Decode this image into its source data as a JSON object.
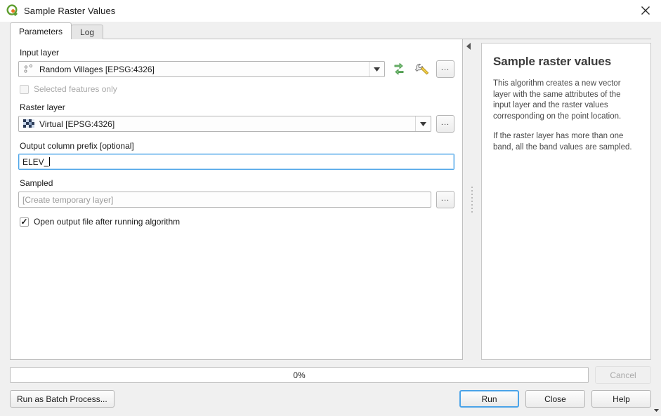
{
  "window": {
    "title": "Sample Raster Values",
    "icon": "qgis-logo-icon",
    "close_icon": "close-icon"
  },
  "tabs": [
    {
      "label": "Parameters",
      "active": true
    },
    {
      "label": "Log",
      "active": false
    }
  ],
  "parameters": {
    "input_layer": {
      "label": "Input layer",
      "value": "Random Villages [EPSG:4326]",
      "icon": "point-vector-layer-icon",
      "iterate_button_icon": "iterate-cycle-icon",
      "advanced_button_icon": "wrench-icon",
      "browse_button_label": "..."
    },
    "selected_features_only": {
      "label": "Selected features only",
      "checked": false,
      "enabled": false
    },
    "raster_layer": {
      "label": "Raster layer",
      "value": "Virtual [EPSG:4326]",
      "icon": "raster-layer-icon",
      "browse_button_label": "..."
    },
    "output_column_prefix": {
      "label": "Output column prefix [optional]",
      "value": "ELEV_",
      "placeholder": ""
    },
    "sampled": {
      "label": "Sampled",
      "value": "",
      "placeholder": "[Create temporary layer]",
      "browse_button_label": "..."
    },
    "open_output": {
      "label": "Open output file after running algorithm",
      "checked": true
    }
  },
  "help": {
    "collapse_icon": "collapse-panel-arrow-icon",
    "title": "Sample raster values",
    "paragraphs": [
      "This algorithm creates a new vector layer with the same attributes of the input layer and the raster values corresponding on the point location.",
      "If the raster layer has more than one band, all the band values are sampled."
    ]
  },
  "footer": {
    "progress_text": "0%",
    "progress_percent": 0,
    "cancel_label": "Cancel",
    "cancel_enabled": false,
    "batch_label": "Run as Batch Process...",
    "run_label": "Run",
    "close_label": "Close",
    "help_label": "Help"
  },
  "colors": {
    "accent": "#4aa3e8",
    "qgis_green": "#5f9e2f",
    "qgis_orange": "#e87722",
    "window_bg": "#f0f0f0",
    "pane_bg": "#ffffff",
    "border": "#b4b4b4"
  }
}
